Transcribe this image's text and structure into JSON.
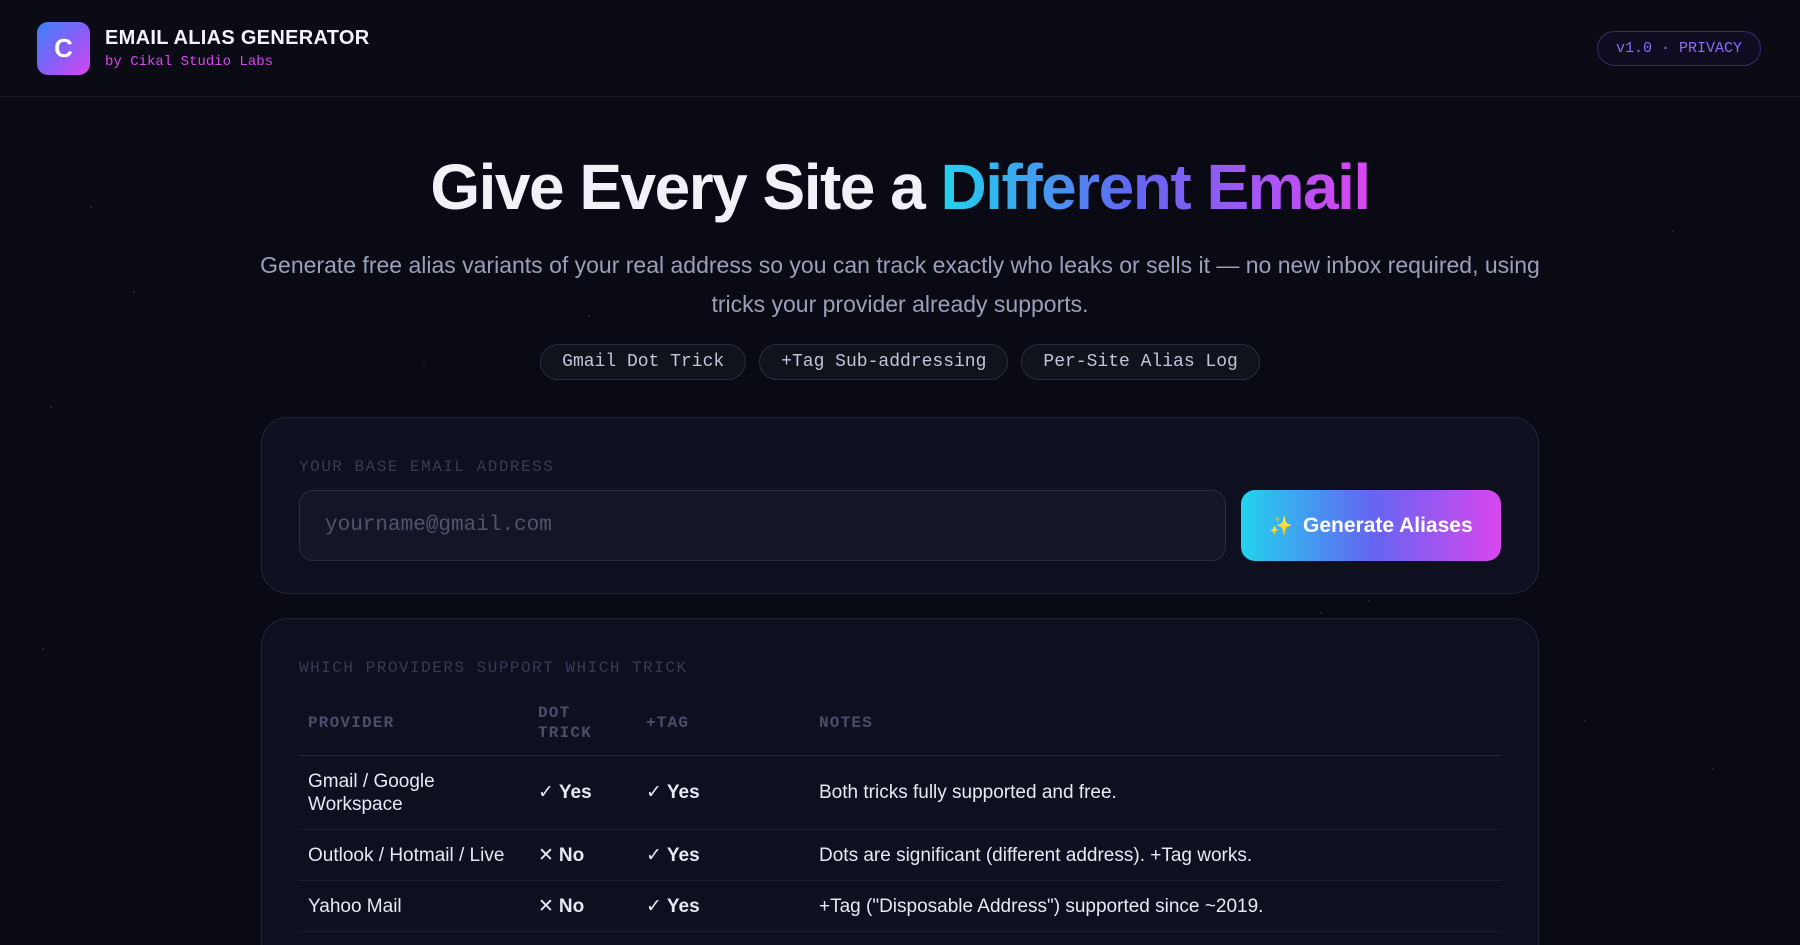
{
  "header": {
    "logo_letter": "C",
    "title": "EMAIL ALIAS GENERATOR",
    "subtitle": "by Cikal Studio Labs",
    "version_badge": "v1.0 · PRIVACY"
  },
  "hero": {
    "title_plain": "Give Every Site a ",
    "title_gradient": "Different Email",
    "subtitle": "Generate free alias variants of your real address so you can track exactly who leaks or sells it — no new inbox required, using tricks your provider already supports.",
    "chips": [
      "Gmail Dot Trick",
      "+Tag Sub-addressing",
      "Per-Site Alias Log"
    ]
  },
  "input_card": {
    "label": "YOUR BASE EMAIL ADDRESS",
    "placeholder": "yourname@gmail.com",
    "value": "",
    "button_icon": "sparkles-icon",
    "button_label": "Generate Aliases"
  },
  "providers_card": {
    "label": "WHICH PROVIDERS SUPPORT WHICH TRICK",
    "columns": [
      "PROVIDER",
      "DOT TRICK",
      "+TAG",
      "NOTES"
    ],
    "rows": [
      {
        "provider": "Gmail / Google Workspace",
        "dot": "Yes",
        "dot_icon": "check-icon",
        "tag": "Yes",
        "tag_icon": "check-icon",
        "notes": "Both tricks fully supported and free."
      },
      {
        "provider": "Outlook / Hotmail / Live",
        "dot": "No",
        "dot_icon": "x-icon",
        "tag": "Yes",
        "tag_icon": "check-icon",
        "notes": "Dots are significant (different address). +Tag works."
      },
      {
        "provider": "Yahoo Mail",
        "dot": "No",
        "dot_icon": "x-icon",
        "tag": "Yes",
        "tag_icon": "check-icon",
        "notes": "+Tag (\"Disposable Address\") supported since ~2019."
      }
    ]
  },
  "colors": {
    "background": "#090a14",
    "accent_cyan": "#22d3ee",
    "accent_violet": "#a855f7",
    "accent_magenta": "#d946ef"
  }
}
